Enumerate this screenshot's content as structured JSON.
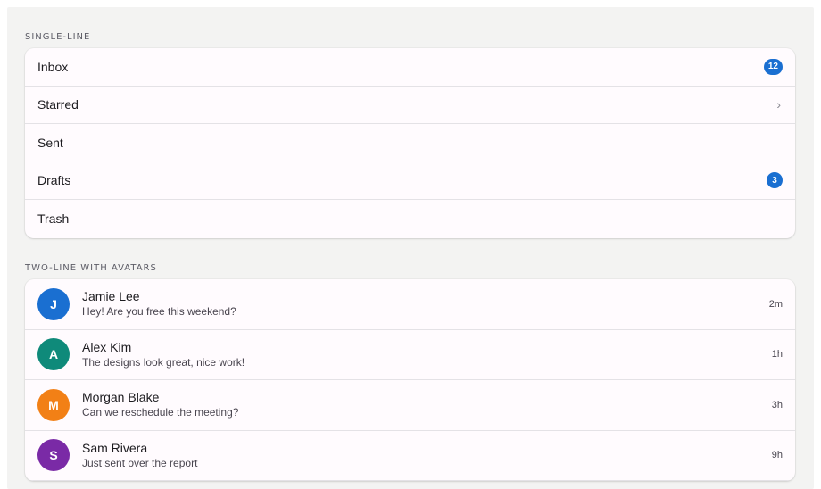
{
  "sections": {
    "single": {
      "label": "SINGLE-LINE",
      "items": [
        {
          "label": "Inbox",
          "badge": "12"
        },
        {
          "label": "Starred",
          "chevron": "›"
        },
        {
          "label": "Sent"
        },
        {
          "label": "Drafts",
          "badge": "3"
        },
        {
          "label": "Trash"
        }
      ]
    },
    "two_line": {
      "label": "TWO-LINE WITH AVATARS",
      "items": [
        {
          "initial": "J",
          "name": "Jamie Lee",
          "message": "Hey! Are you free this weekend?",
          "time": "2m",
          "color": "#1a6fd1"
        },
        {
          "initial": "A",
          "name": "Alex Kim",
          "message": "The designs look great, nice work!",
          "time": "1h",
          "color": "#0f8a7a"
        },
        {
          "initial": "M",
          "name": "Morgan Blake",
          "message": "Can we reschedule the meeting?",
          "time": "3h",
          "color": "#f28016"
        },
        {
          "initial": "S",
          "name": "Sam Rivera",
          "message": "Just sent over the report",
          "time": "9h",
          "color": "#7a2aa6"
        }
      ]
    }
  },
  "colors": {
    "accent": "#1a6fd1",
    "background": "#f3f3f2",
    "card": "#fffbfe"
  }
}
